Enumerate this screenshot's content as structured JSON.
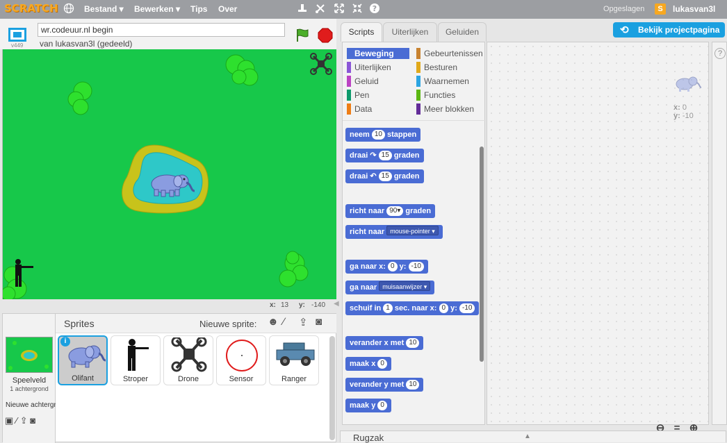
{
  "topbar": {
    "logo": "SCRATCH",
    "menus": [
      "Bestand ▾",
      "Bewerken ▾",
      "Tips",
      "Over"
    ],
    "saved": "Opgeslagen",
    "username": "lukasvan3l"
  },
  "stage_header": {
    "project_title": "wr.codeuur.nl begin",
    "byline": "van lukasvan3l (gedeeld)",
    "version": "v449"
  },
  "stage_coords": {
    "x_label": "x:",
    "x_value": "13",
    "y_label": "y:",
    "y_value": "-140"
  },
  "sprite_pane": {
    "title": "Sprites",
    "new_sprite_label": "Nieuwe sprite:",
    "stage_label": "Speelveld",
    "stage_backdrops": "1 achtergrond",
    "new_backdrop_label": "Nieuwe achtergr",
    "sprites": [
      "Olifant",
      "Stroper",
      "Drone",
      "Sensor",
      "Ranger"
    ],
    "selected_sprite": "Olifant"
  },
  "tabs": [
    "Scripts",
    "Uiterlijken",
    "Geluiden"
  ],
  "active_tab": "Scripts",
  "view_project_button": "Bekijk projectpagina",
  "categories": [
    {
      "label": "Beweging",
      "color": "#4a6cd4"
    },
    {
      "label": "Gebeurtenissen",
      "color": "#c88330"
    },
    {
      "label": "Uiterlijken",
      "color": "#8a55d7"
    },
    {
      "label": "Besturen",
      "color": "#e1a91a"
    },
    {
      "label": "Geluid",
      "color": "#bb42c3"
    },
    {
      "label": "Waarnemen",
      "color": "#2ca5e2"
    },
    {
      "label": "Pen",
      "color": "#0e9a6c"
    },
    {
      "label": "Functies",
      "color": "#5cb712"
    },
    {
      "label": "Data",
      "color": "#ee7d16"
    },
    {
      "label": "Meer blokken",
      "color": "#632d99"
    }
  ],
  "blocks": {
    "move": {
      "label": "neem",
      "value": "10",
      "suffix": "stappen"
    },
    "turn_right": {
      "label": "draai",
      "icon": "↷",
      "value": "15",
      "suffix": "graden"
    },
    "turn_left": {
      "label": "draai",
      "icon": "↶",
      "value": "15",
      "suffix": "graden"
    },
    "point_dir": {
      "label": "richt naar",
      "value": "90▾",
      "suffix": "graden"
    },
    "point_towards": {
      "label": "richt naar",
      "value": "mouse-pointer ▾"
    },
    "goto_xy": {
      "label": "ga naar x:",
      "x": "0",
      "ylabel": "y:",
      "y": "-10"
    },
    "goto": {
      "label": "ga naar",
      "value": "muisaanwijzer ▾"
    },
    "glide": {
      "label": "schuif in",
      "secs": "1",
      "mid": "sec. naar x:",
      "x": "0",
      "ylabel": "y:",
      "y": "-10"
    },
    "change_x": {
      "label": "verander x met",
      "value": "10"
    },
    "set_x": {
      "label": "maak x",
      "value": "0"
    },
    "change_y": {
      "label": "verander y met",
      "value": "10"
    },
    "set_y": {
      "label": "maak y",
      "value": "0"
    }
  },
  "script_sprite": {
    "x_label": "x:",
    "x_value": "0",
    "y_label": "y:",
    "y_value": "-10"
  },
  "zoom": {
    "out": "−",
    "reset": "=",
    "in": "+"
  },
  "backpack": {
    "label": "Rugzak",
    "arrow": "▲"
  },
  "help": "?"
}
